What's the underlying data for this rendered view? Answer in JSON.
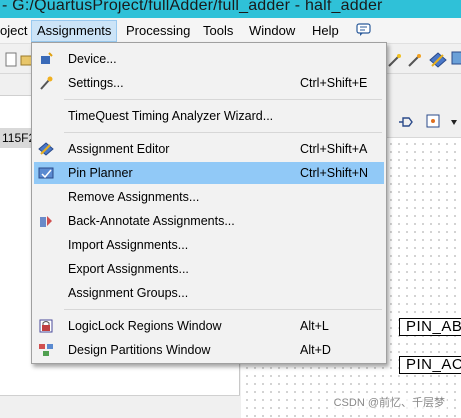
{
  "window": {
    "title": "- G:/QuartusProject/fullAdder/full_adder - half_adder"
  },
  "menubar": {
    "items": [
      {
        "label": "oject"
      },
      {
        "label": "Assignments"
      },
      {
        "label": "Processing"
      },
      {
        "label": "Tools"
      },
      {
        "label": "Window"
      },
      {
        "label": "Help"
      }
    ]
  },
  "left_panel": {
    "selected_row_text": "115F2"
  },
  "assignments_menu": {
    "items": [
      {
        "label": "Device...",
        "shortcut": "",
        "icon": "device-chip-icon"
      },
      {
        "label": "Settings...",
        "shortcut": "Ctrl+Shift+E",
        "icon": "settings-wand-icon"
      },
      {
        "label": "TimeQuest Timing Analyzer Wizard...",
        "shortcut": "",
        "icon": ""
      },
      {
        "label": "Assignment Editor",
        "shortcut": "Ctrl+Shift+A",
        "icon": "assignment-editor-icon"
      },
      {
        "label": "Pin Planner",
        "shortcut": "Ctrl+Shift+N",
        "icon": "pin-planner-icon"
      },
      {
        "label": "Remove Assignments...",
        "shortcut": "",
        "icon": ""
      },
      {
        "label": "Back-Annotate Assignments...",
        "shortcut": "",
        "icon": "back-annotate-icon"
      },
      {
        "label": "Import Assignments...",
        "shortcut": "",
        "icon": ""
      },
      {
        "label": "Export Assignments...",
        "shortcut": "",
        "icon": ""
      },
      {
        "label": "Assignment Groups...",
        "shortcut": "",
        "icon": ""
      },
      {
        "label": "LogicLock Regions Window",
        "shortcut": "Alt+L",
        "icon": "logiclock-icon"
      },
      {
        "label": "Design Partitions Window",
        "shortcut": "Alt+D",
        "icon": "design-partitions-icon"
      }
    ],
    "highlighted_index": 4
  },
  "canvas": {
    "pins": [
      {
        "label": "PIN_AB"
      },
      {
        "label": "PIN_AC"
      }
    ]
  },
  "watermark": "CSDN @前忆、千层梦",
  "colors": {
    "titlebar": "#2fc1d8",
    "menu_highlight": "#91c9f7",
    "active_menu": "#cce4f7"
  }
}
